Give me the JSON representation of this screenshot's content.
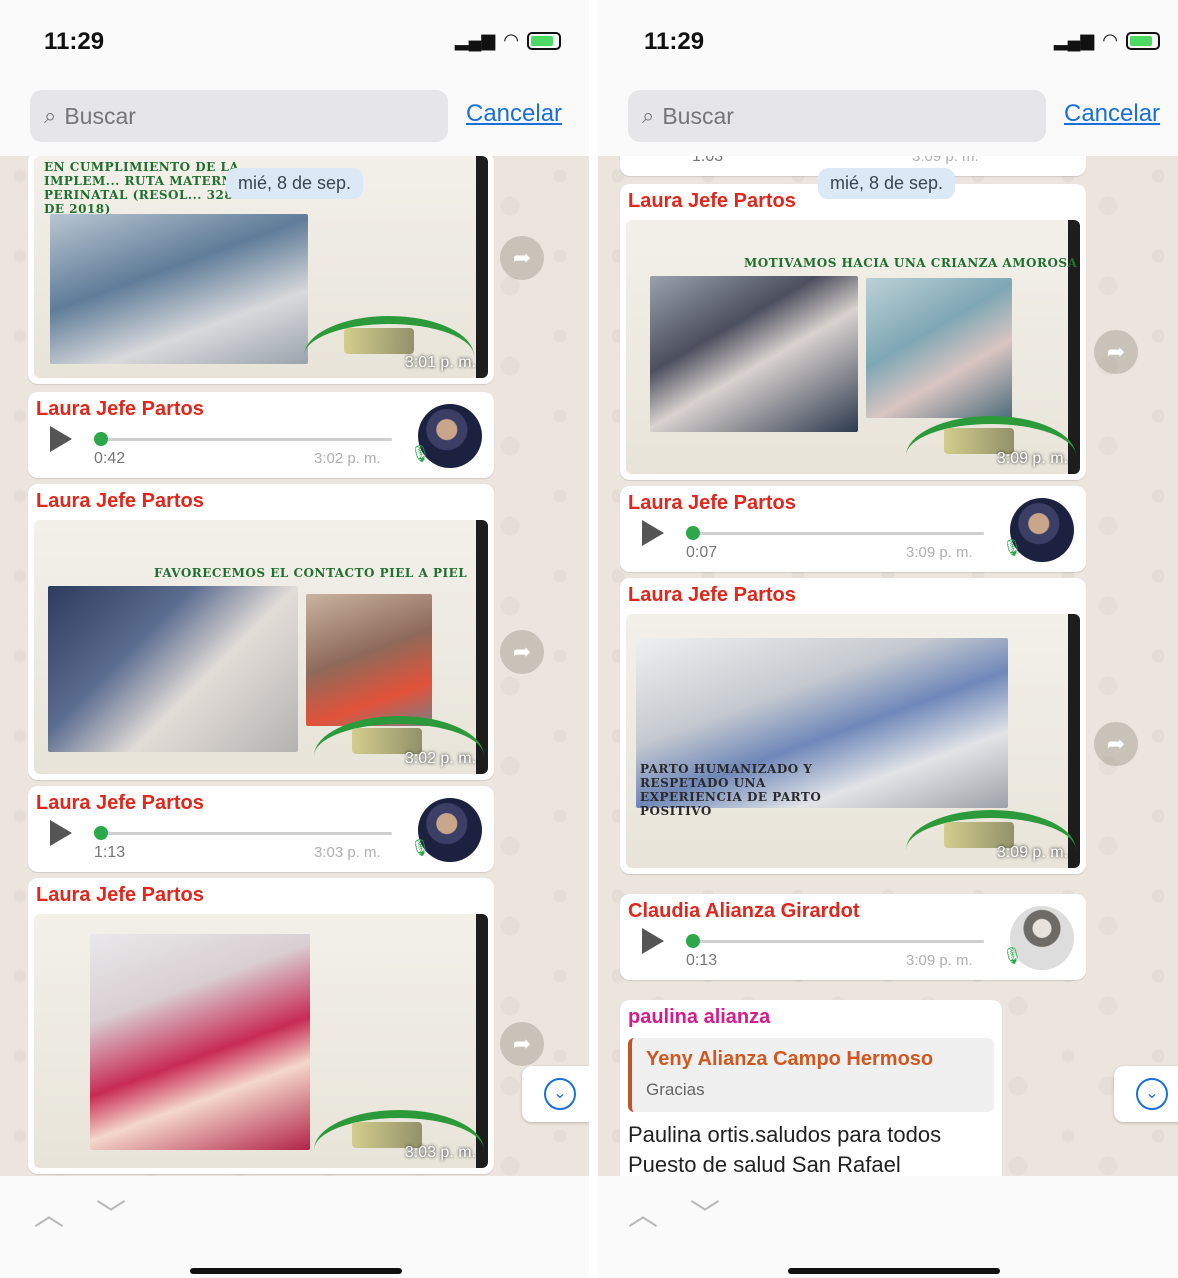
{
  "left": {
    "status": {
      "time": "11:29"
    },
    "search": {
      "placeholder": "Buscar",
      "cancel": "Cancelar"
    },
    "date_chip": "mié, 8 de sep.",
    "messages": [
      {
        "type": "image",
        "time": "3:01 p. m.",
        "slide_heading": "EN CUMPLIMIENTO DE LA IMPLEM... RUTA MATERNO PERINATAL (RESOL... 3280 DE 2018)"
      },
      {
        "type": "audio",
        "sender": "Laura Jefe Partos",
        "duration": "0:42",
        "time": "3:02 p. m."
      },
      {
        "type": "image",
        "sender": "Laura Jefe Partos",
        "time": "3:02 p. m.",
        "slide_heading": "FAVORECEMOS EL CONTACTO PIEL A PIEL"
      },
      {
        "type": "audio",
        "sender": "Laura Jefe Partos",
        "duration": "1:13",
        "time": "3:03 p. m."
      },
      {
        "type": "image",
        "sender": "Laura Jefe Partos",
        "time": "3:03 p. m."
      }
    ]
  },
  "right": {
    "status": {
      "time": "11:29"
    },
    "search": {
      "placeholder": "Buscar",
      "cancel": "Cancelar"
    },
    "date_chip": "mié, 8 de sep.",
    "partial_top": {
      "duration": "1:03",
      "time": "3:09 p. m."
    },
    "messages": [
      {
        "type": "image",
        "sender": "Laura Jefe Partos",
        "time": "3:09 p. m.",
        "slide_heading": "MOTIVAMOS HACIA UNA CRIANZA AMOROSA"
      },
      {
        "type": "audio",
        "sender": "Laura Jefe Partos",
        "duration": "0:07",
        "time": "3:09 p. m."
      },
      {
        "type": "image",
        "sender": "Laura Jefe Partos",
        "time": "3:09 p. m.",
        "slide_heading": "PARTO HUMANIZADO Y RESPETADO UNA EXPERIENCIA DE PARTO POSITIVO"
      },
      {
        "type": "audio",
        "sender": "Claudia Alianza Girardot",
        "duration": "0:13",
        "time": "3:09 p. m."
      },
      {
        "type": "reply",
        "sender": "paulina alianza",
        "quoted_name": "Yeny Alianza Campo Hermoso",
        "quoted_text": "Gracias",
        "lines": [
          "Paulina ortis.saludos para todos",
          "Puesto de salud San Rafael"
        ]
      }
    ]
  },
  "colors": {
    "sender": "#e0271c",
    "link": "#1a6fd8",
    "chat_bg": "#ece5dd",
    "audio_green": "#2aa84a"
  }
}
